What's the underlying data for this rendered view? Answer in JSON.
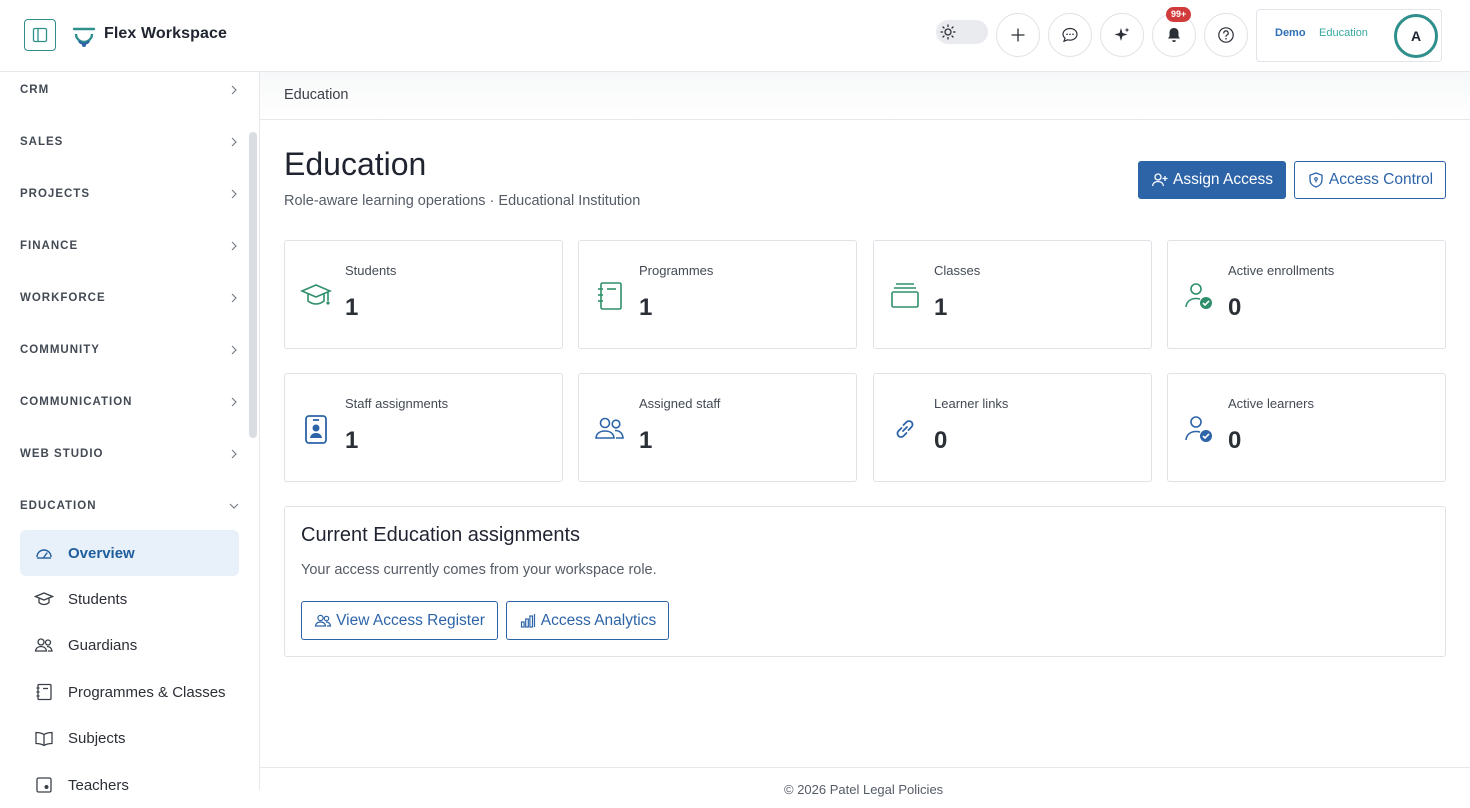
{
  "header": {
    "brand_name": "Flex Workspace",
    "notification_count": "99+",
    "user_tag_primary": "Demo",
    "user_tag_secondary": "Education",
    "avatar_initial": "A"
  },
  "sidebar": {
    "sections": [
      "CRM",
      "SALES",
      "PROJECTS",
      "FINANCE",
      "WORKFORCE",
      "COMMUNITY",
      "COMMUNICATION",
      "WEB STUDIO",
      "EDUCATION"
    ],
    "education_items": [
      {
        "label": "Overview",
        "icon": "dashboard-gauge-icon"
      },
      {
        "label": "Students",
        "icon": "graduation-cap-icon"
      },
      {
        "label": "Guardians",
        "icon": "users-icon"
      },
      {
        "label": "Programmes & Classes",
        "icon": "notebook-icon"
      },
      {
        "label": "Subjects",
        "icon": "book-open-icon"
      },
      {
        "label": "Teachers",
        "icon": "badge-icon"
      }
    ]
  },
  "breadcrumb": "Education",
  "page": {
    "title": "Education",
    "subtitle": "Role-aware learning operations · Educational Institution",
    "assign_access_label": "Assign Access",
    "access_control_label": "Access Control"
  },
  "stats": [
    {
      "label": "Students",
      "value": "1",
      "icon": "graduation-cap-icon"
    },
    {
      "label": "Programmes",
      "value": "1",
      "icon": "notebook-icon"
    },
    {
      "label": "Classes",
      "value": "1",
      "icon": "stack-icon"
    },
    {
      "label": "Active enrollments",
      "value": "0",
      "icon": "user-check-icon"
    },
    {
      "label": "Staff assignments",
      "value": "1",
      "icon": "id-badge-icon"
    },
    {
      "label": "Assigned staff",
      "value": "1",
      "icon": "users-icon"
    },
    {
      "label": "Learner links",
      "value": "0",
      "icon": "link-icon"
    },
    {
      "label": "Active learners",
      "value": "0",
      "icon": "user-verified-icon"
    }
  ],
  "assignments": {
    "title": "Current Education assignments",
    "description": "Your access currently comes from your workspace role.",
    "view_register_label": "View Access Register",
    "analytics_label": "Access Analytics"
  },
  "footer": {
    "text": "© 2026 Patel Legal Policies"
  },
  "colors": {
    "primary": "#2d64a8",
    "accent_green": "#2f8f6a",
    "active_nav_bg": "#e8f1fa",
    "badge_red": "#d23b3b"
  }
}
